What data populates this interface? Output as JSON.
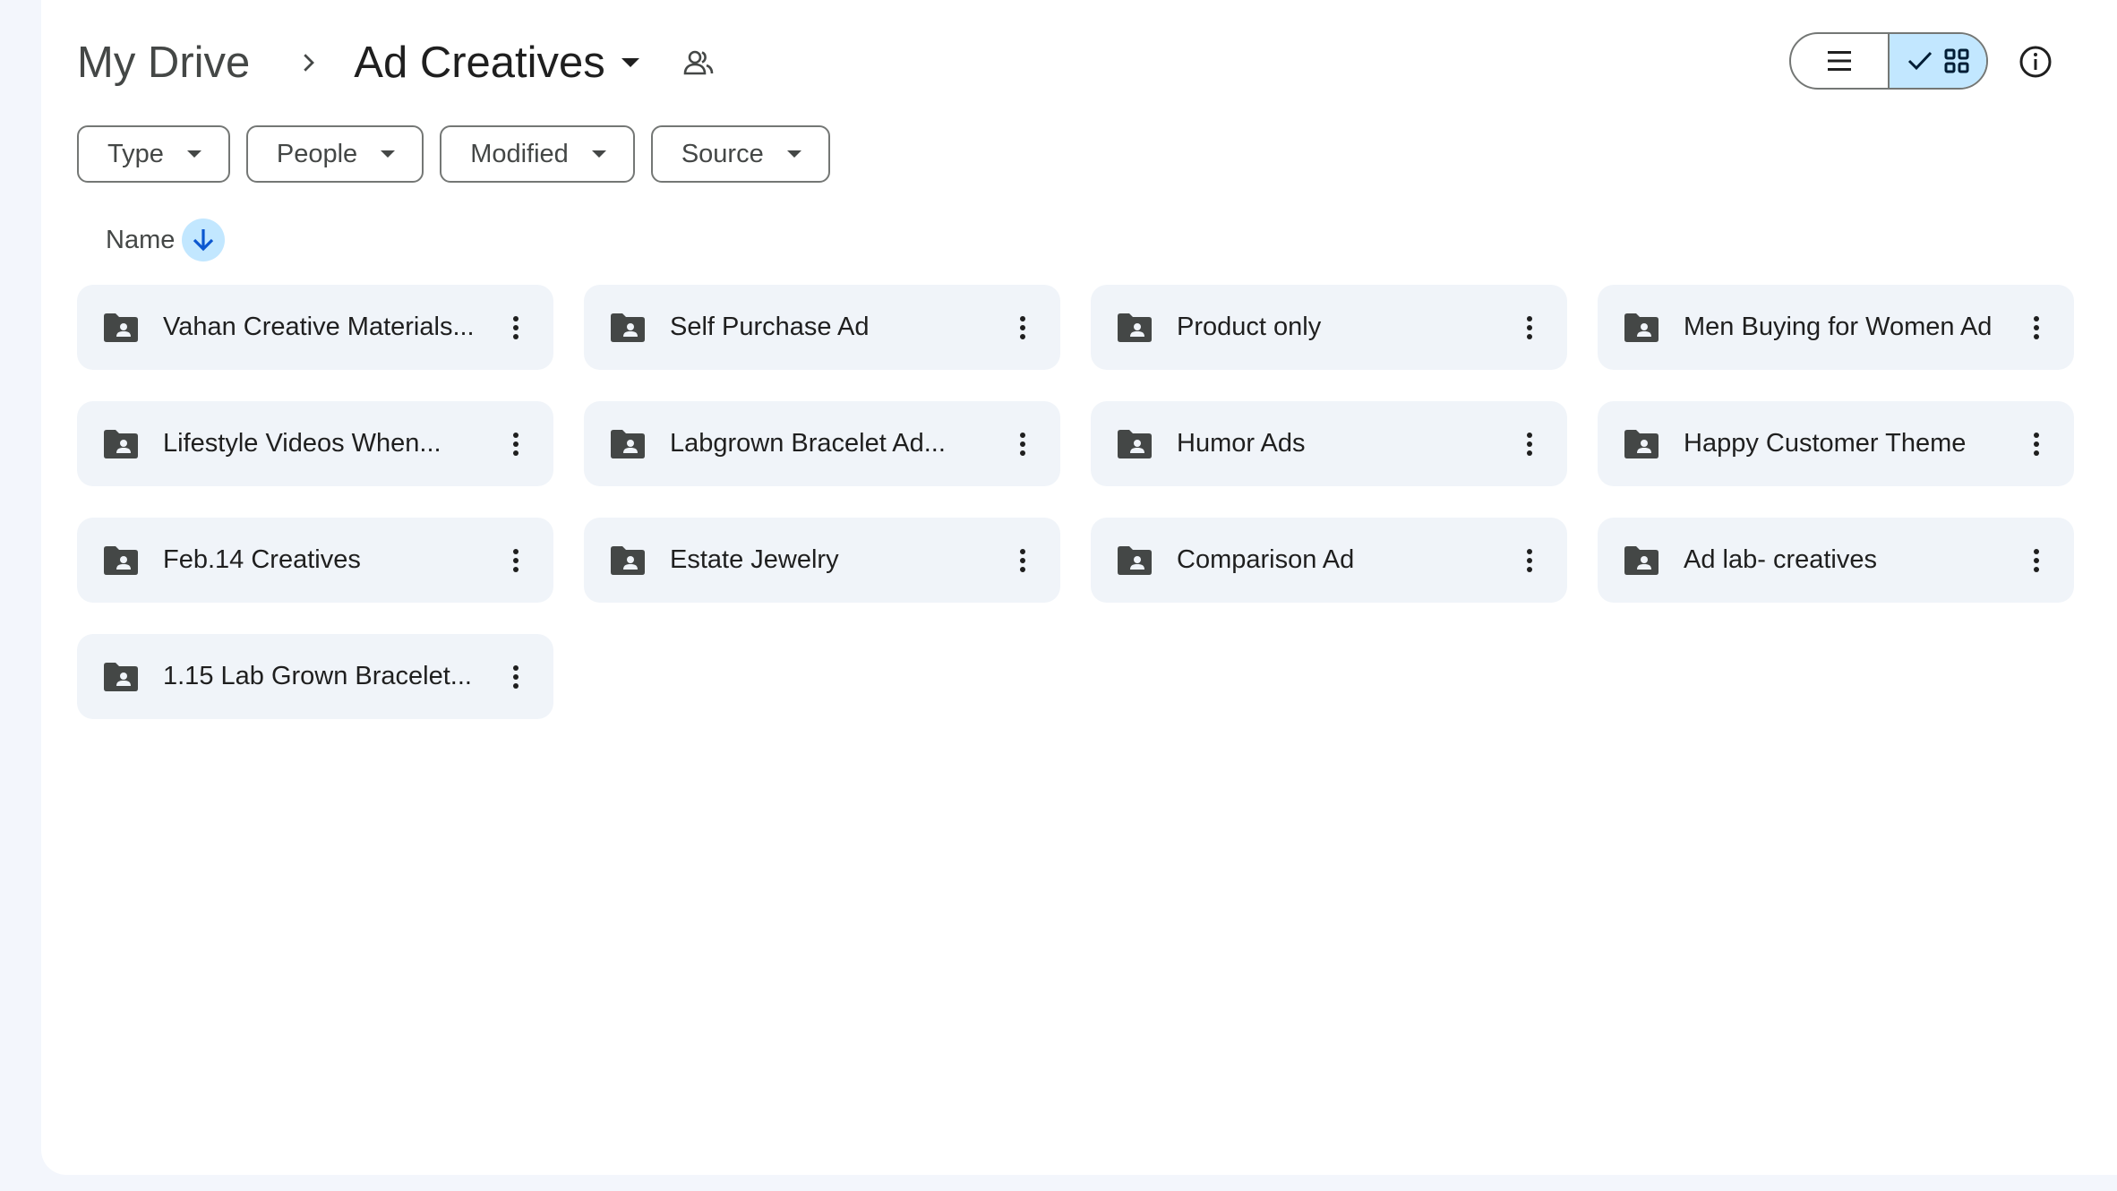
{
  "breadcrumb": {
    "root": "My Drive",
    "current": "Ad Creatives"
  },
  "icons": {
    "separator": "chevron-right-icon",
    "shared": "people-icon",
    "list_view": "list-icon",
    "grid_view": "grid-icon",
    "check": "check-icon",
    "info": "info-icon",
    "folder": "shared-folder-icon",
    "more": "more-vert-icon",
    "sort": "arrow-down-icon"
  },
  "filters": [
    {
      "label": "Type"
    },
    {
      "label": "People"
    },
    {
      "label": "Modified"
    },
    {
      "label": "Source"
    }
  ],
  "sort": {
    "label": "Name",
    "direction": "descending"
  },
  "view": {
    "active": "grid"
  },
  "folders": [
    {
      "name": "Vahan Creative Materials..."
    },
    {
      "name": "Self Purchase Ad"
    },
    {
      "name": "Product only"
    },
    {
      "name": "Men Buying for Women Ad"
    },
    {
      "name": "Lifestyle Videos When..."
    },
    {
      "name": "Labgrown Bracelet Ad..."
    },
    {
      "name": "Humor Ads"
    },
    {
      "name": "Happy Customer Theme"
    },
    {
      "name": "Feb.14 Creatives"
    },
    {
      "name": "Estate Jewelry"
    },
    {
      "name": "Comparison Ad"
    },
    {
      "name": "Ad lab- creatives"
    },
    {
      "name": "1.15 Lab Grown Bracelet..."
    }
  ],
  "colors": {
    "background": "#f3f6fc",
    "panel": "#ffffff",
    "card": "#f0f4f9",
    "accent": "#c2e7ff",
    "icon": "#444746",
    "sort_arrow": "#0b57d0"
  }
}
